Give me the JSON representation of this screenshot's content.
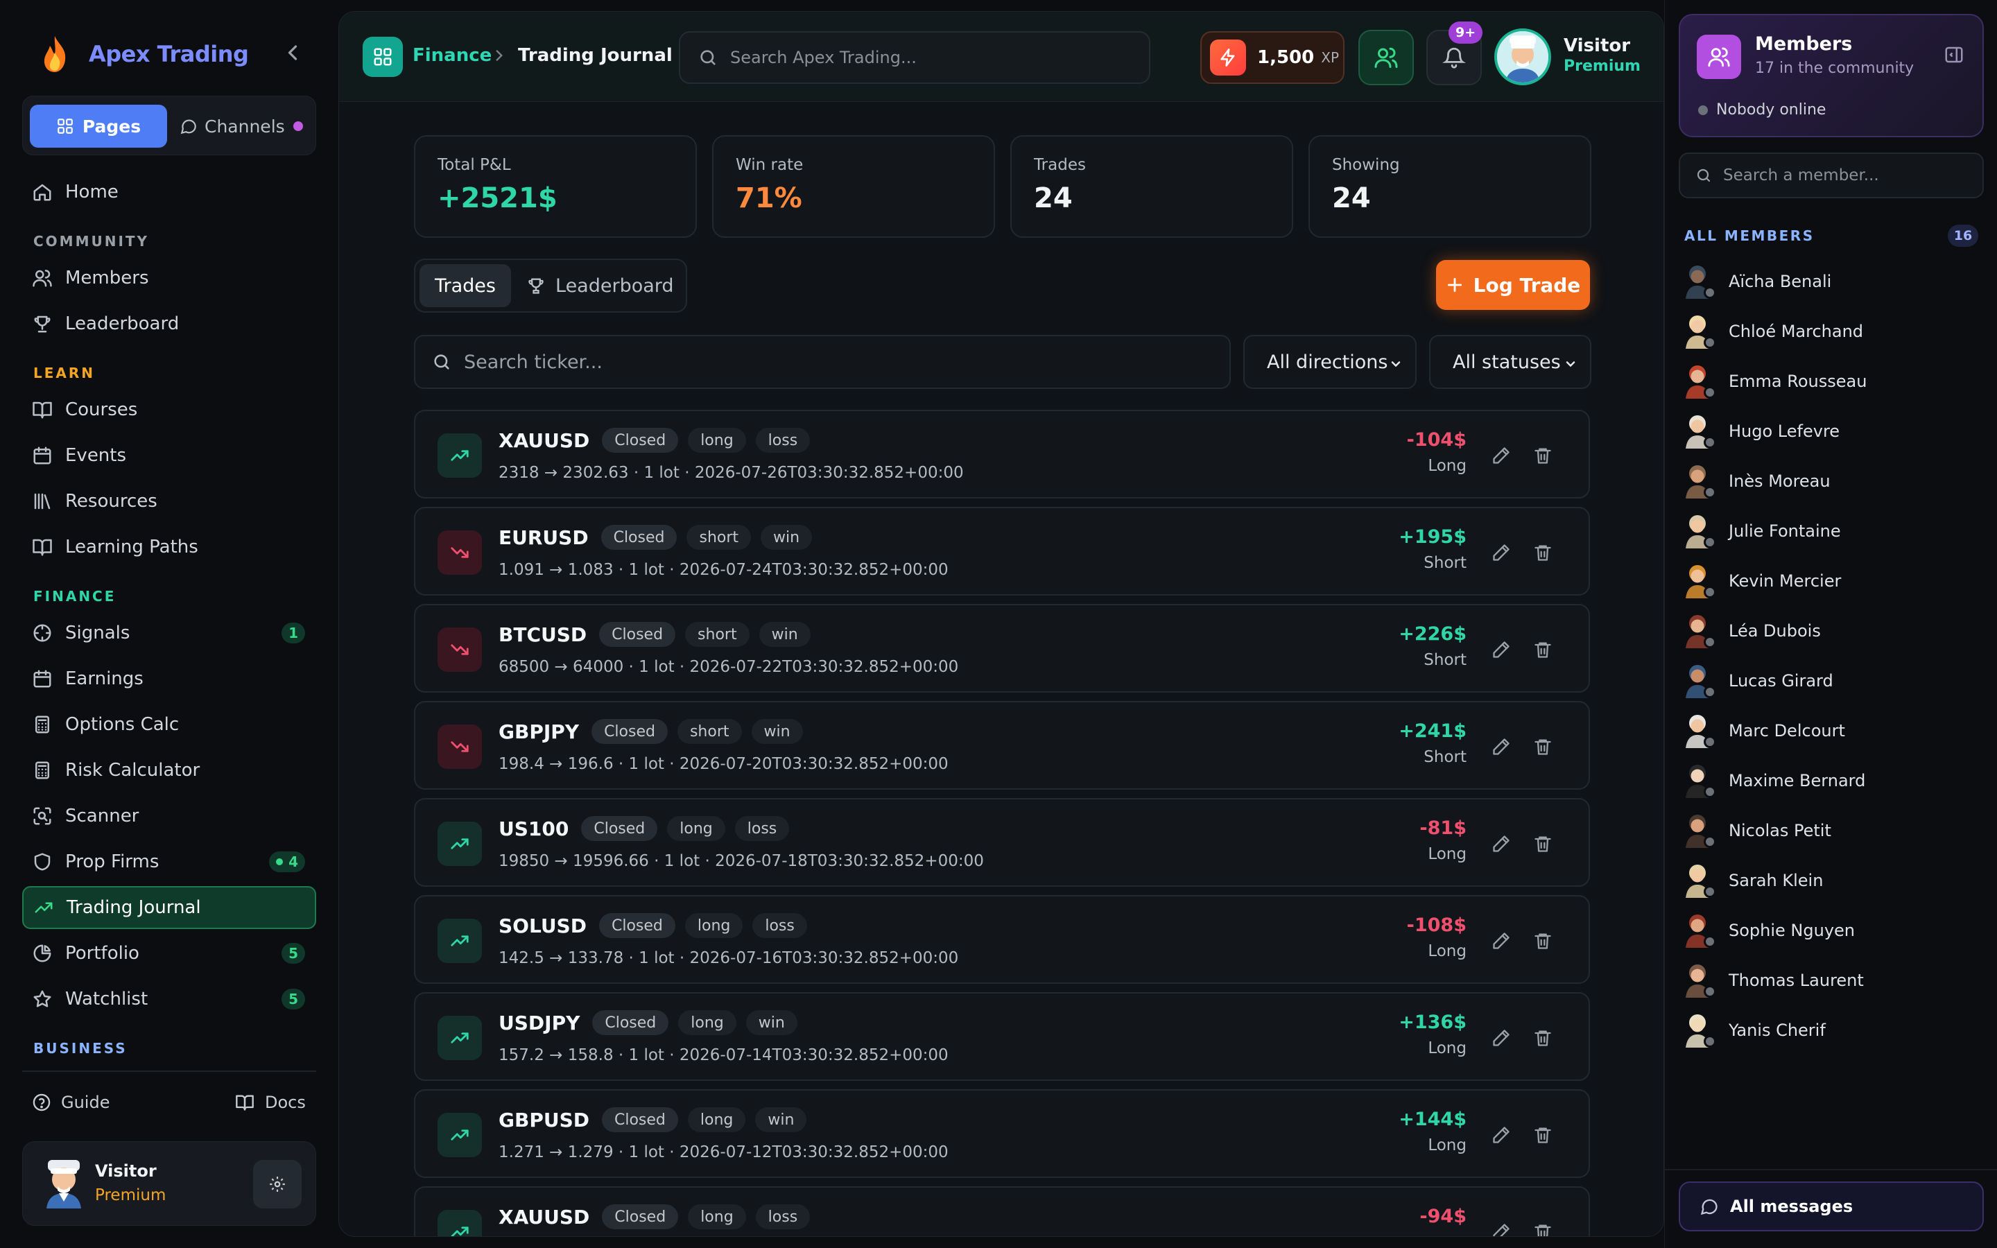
{
  "app": {
    "name": "Apex Trading"
  },
  "sidebar": {
    "tabs": {
      "pages": "Pages",
      "channels": "Channels"
    },
    "items": [
      {
        "label": "Home",
        "icon": "home-icon"
      },
      {
        "section": "COMMUNITY",
        "color": "#9aa0a7"
      },
      {
        "label": "Members",
        "icon": "users-icon"
      },
      {
        "label": "Leaderboard",
        "icon": "trophy-icon"
      },
      {
        "section": "LEARN",
        "color": "#f5a524"
      },
      {
        "label": "Courses",
        "icon": "book-icon"
      },
      {
        "label": "Events",
        "icon": "calendar-icon"
      },
      {
        "label": "Resources",
        "icon": "library-icon"
      },
      {
        "label": "Learning Paths",
        "icon": "book-icon"
      },
      {
        "section": "FINANCE",
        "color": "#2fd6a8"
      },
      {
        "label": "Signals",
        "icon": "crosshair-icon",
        "badge": "1"
      },
      {
        "label": "Earnings",
        "icon": "calendar-icon"
      },
      {
        "label": "Options Calc",
        "icon": "calculator-icon"
      },
      {
        "label": "Risk Calculator",
        "icon": "calculator-icon"
      },
      {
        "label": "Scanner",
        "icon": "scan-icon"
      },
      {
        "label": "Prop Firms",
        "icon": "shield-icon",
        "badge": "4",
        "badge_dot": true
      },
      {
        "label": "Trading Journal",
        "icon": "trending-up-icon",
        "active": true
      },
      {
        "label": "Portfolio",
        "icon": "pie-chart-icon",
        "badge": "5"
      },
      {
        "label": "Watchlist",
        "icon": "star-icon",
        "badge": "5"
      },
      {
        "section": "BUSINESS",
        "color": "#8ab4ff"
      }
    ],
    "footer": {
      "guide": "Guide",
      "docs": "Docs"
    },
    "user": {
      "name": "Visitor",
      "tier": "Premium"
    }
  },
  "header": {
    "breadcrumb": {
      "section": "Finance",
      "page": "Trading Journal"
    },
    "search_placeholder": "Search Apex Trading...",
    "xp_value": "1,500",
    "xp_unit": "XP",
    "notifications_badge": "9+",
    "user": {
      "name": "Visitor",
      "tier": "Premium"
    }
  },
  "stats": [
    {
      "label": "Total P&L",
      "value": "+2521$",
      "color": "#2fd6a8"
    },
    {
      "label": "Win rate",
      "value": "71%",
      "color": "#ff8a3d"
    },
    {
      "label": "Trades",
      "value": "24",
      "color": "#f1f3f5"
    },
    {
      "label": "Showing",
      "value": "24",
      "color": "#f1f3f5"
    }
  ],
  "tabs": {
    "trades": "Trades",
    "leaderboard": "Leaderboard"
  },
  "log_trade_label": "Log Trade",
  "filters": {
    "search_placeholder": "Search ticker...",
    "direction": "All directions",
    "status": "All statuses"
  },
  "trades": [
    {
      "ticker": "XAUUSD",
      "status": "Closed",
      "direction": "long",
      "result": "loss",
      "detail": "2318 → 2302.63 · 1 lot · 2026-07-26T03:30:32.852+00:00",
      "pnl": "-104$",
      "side": "Long",
      "trend": "up",
      "positive": false
    },
    {
      "ticker": "EURUSD",
      "status": "Closed",
      "direction": "short",
      "result": "win",
      "detail": "1.091 → 1.083 · 1 lot · 2026-07-24T03:30:32.852+00:00",
      "pnl": "+195$",
      "side": "Short",
      "trend": "down",
      "positive": true
    },
    {
      "ticker": "BTCUSD",
      "status": "Closed",
      "direction": "short",
      "result": "win",
      "detail": "68500 → 64000 · 1 lot · 2026-07-22T03:30:32.852+00:00",
      "pnl": "+226$",
      "side": "Short",
      "trend": "down",
      "positive": true
    },
    {
      "ticker": "GBPJPY",
      "status": "Closed",
      "direction": "short",
      "result": "win",
      "detail": "198.4 → 196.6 · 1 lot · 2026-07-20T03:30:32.852+00:00",
      "pnl": "+241$",
      "side": "Short",
      "trend": "down",
      "positive": true
    },
    {
      "ticker": "US100",
      "status": "Closed",
      "direction": "long",
      "result": "loss",
      "detail": "19850 → 19596.66 · 1 lot · 2026-07-18T03:30:32.852+00:00",
      "pnl": "-81$",
      "side": "Long",
      "trend": "up",
      "positive": false
    },
    {
      "ticker": "SOLUSD",
      "status": "Closed",
      "direction": "long",
      "result": "loss",
      "detail": "142.5 → 133.78 · 1 lot · 2026-07-16T03:30:32.852+00:00",
      "pnl": "-108$",
      "side": "Long",
      "trend": "up",
      "positive": false
    },
    {
      "ticker": "USDJPY",
      "status": "Closed",
      "direction": "long",
      "result": "win",
      "detail": "157.2 → 158.8 · 1 lot · 2026-07-14T03:30:32.852+00:00",
      "pnl": "+136$",
      "side": "Long",
      "trend": "up",
      "positive": true
    },
    {
      "ticker": "GBPUSD",
      "status": "Closed",
      "direction": "long",
      "result": "win",
      "detail": "1.271 → 1.279 · 1 lot · 2026-07-12T03:30:32.852+00:00",
      "pnl": "+144$",
      "side": "Long",
      "trend": "up",
      "positive": true
    },
    {
      "ticker": "XAUUSD",
      "status": "Closed",
      "direction": "long",
      "result": "loss",
      "detail": "",
      "pnl": "-94$",
      "side": "",
      "trend": "up",
      "positive": false
    }
  ],
  "members_panel": {
    "title": "Members",
    "subtitle": "17 in the community",
    "online_status": "Nobody online",
    "search_placeholder": "Search a member...",
    "list_label": "ALL MEMBERS",
    "count": "16",
    "members": [
      {
        "name": "Aïcha Benali",
        "skin": "#8a6a55",
        "hair": "#3a4b5e"
      },
      {
        "name": "Chloé Marchand",
        "skin": "#f1c9a3",
        "hair": "#f0d9a8"
      },
      {
        "name": "Emma Rousseau",
        "skin": "#e8b592",
        "hair": "#c2452d"
      },
      {
        "name": "Hugo Lefevre",
        "skin": "#f0c6a0",
        "hair": "#e9e2d6"
      },
      {
        "name": "Inès Moreau",
        "skin": "#d9a27d",
        "hair": "#8b6a4f"
      },
      {
        "name": "Julie Fontaine",
        "skin": "#f1c7a1",
        "hair": "#d8c9a8"
      },
      {
        "name": "Kevin Mercier",
        "skin": "#f0c09a",
        "hair": "#d9912f"
      },
      {
        "name": "Léa Dubois",
        "skin": "#e8b592",
        "hair": "#8a3b2d"
      },
      {
        "name": "Lucas Girard",
        "skin": "#c98d6a",
        "hair": "#3a5d86"
      },
      {
        "name": "Marc Delcourt",
        "skin": "#f0c6a0",
        "hair": "#e8e6e2"
      },
      {
        "name": "Maxime Bernard",
        "skin": "#f0d3b8",
        "hair": "#2a2a2a"
      },
      {
        "name": "Nicolas Petit",
        "skin": "#d9a27d",
        "hair": "#4a3a30"
      },
      {
        "name": "Sarah Klein",
        "skin": "#f1c9a3",
        "hair": "#e6d3a5"
      },
      {
        "name": "Sophie Nguyen",
        "skin": "#e0a882",
        "hair": "#9b3a2a"
      },
      {
        "name": "Thomas Laurent",
        "skin": "#e8b592",
        "hair": "#7a5a48"
      },
      {
        "name": "Yanis Cherif",
        "skin": "#f0d9b5",
        "hair": "#e9e0c8"
      }
    ],
    "all_messages": "All messages"
  }
}
